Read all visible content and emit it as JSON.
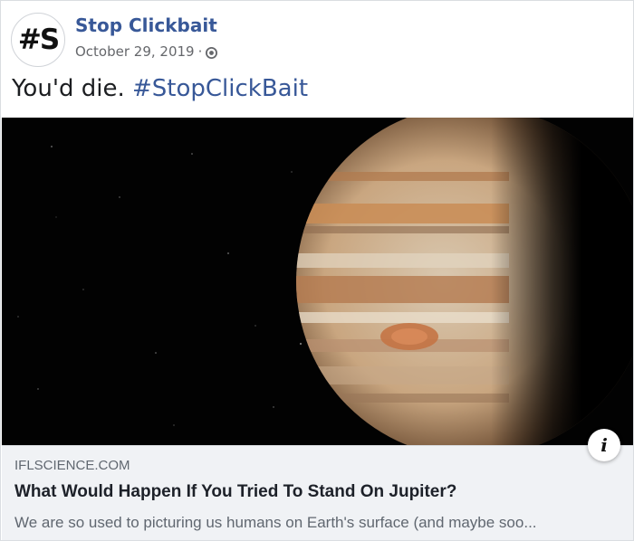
{
  "post": {
    "avatar_text": "#S",
    "page_name": "Stop Clickbait",
    "date": "October 29, 2019",
    "separator": "·",
    "privacy_icon": "globe-icon",
    "message_text": "You'd die.",
    "message_hashtag": "#StopClickBait"
  },
  "link_preview": {
    "image": "jupiter-image",
    "info_icon": "info-icon",
    "info_glyph": "i",
    "domain": "IFLSCIENCE.COM",
    "title": "What Would Happen If You Tried To Stand On Jupiter?",
    "description": "We are so used to picturing us humans on Earth's surface (and maybe soo..."
  },
  "colors": {
    "link_blue": "#385898",
    "meta_gray": "#65676b",
    "preview_bg": "#f0f2f5"
  }
}
